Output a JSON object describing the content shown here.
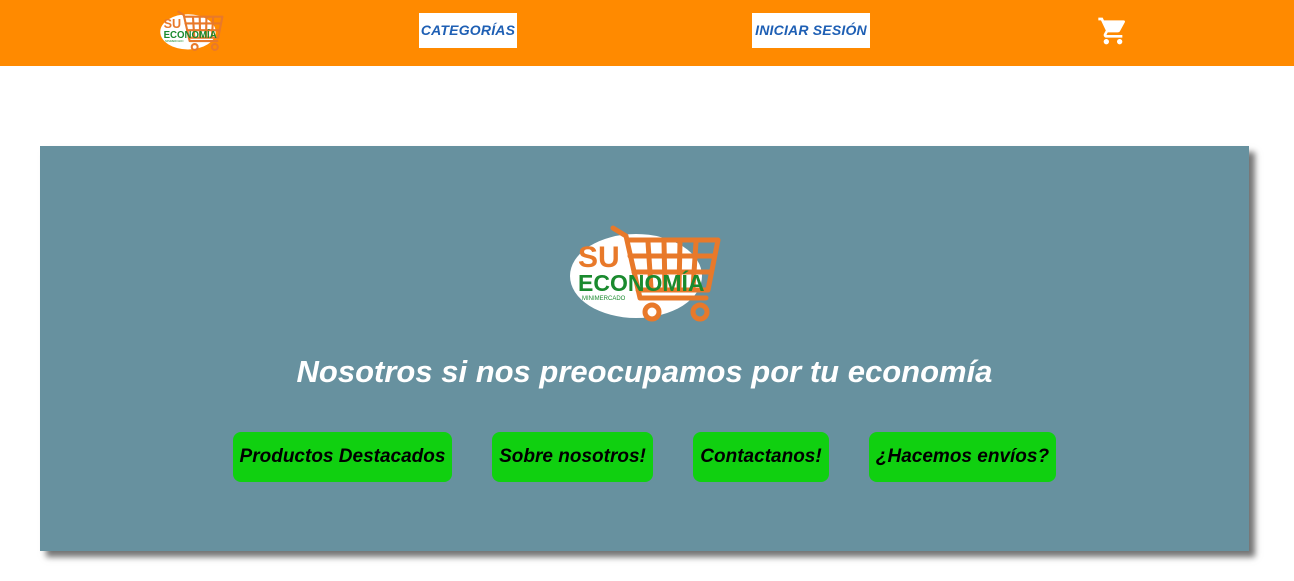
{
  "brand": {
    "logo_line1": "SU",
    "logo_line2": "ECONOMÍA",
    "logo_line3": "MINIMERCADO",
    "colors": {
      "orange": "#ff8a00",
      "green": "#1a8a2e",
      "cart": "#e8792a"
    }
  },
  "header": {
    "categories_label": "CATEGORÍAS",
    "login_label": "INICIAR SESIÓN",
    "cart_icon": "shopping-cart-icon",
    "background": "#ff8a00"
  },
  "hero": {
    "tagline": "Nosotros si nos preocupamos por tu economía",
    "background": "#67919f",
    "buttons": [
      {
        "label": "Productos Destacados"
      },
      {
        "label": "Sobre nosotros!"
      },
      {
        "label": "Contactanos!"
      },
      {
        "label": "¿Hacemos envíos?"
      }
    ],
    "button_color": "#10d010"
  }
}
